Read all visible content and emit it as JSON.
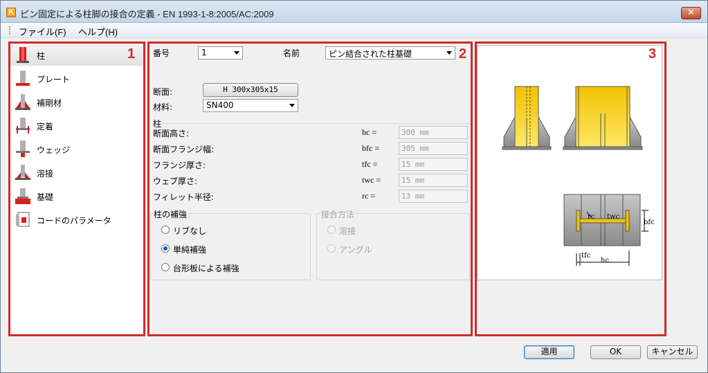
{
  "window": {
    "title": "ピン固定による柱脚の接合の定義 - EN 1993-1-8:2005/AC:2009",
    "close_label": "✕"
  },
  "menu": {
    "file": "ファイル(F)",
    "help": "ヘルプ(H)"
  },
  "regions": {
    "r1": "1",
    "r2": "2",
    "r3": "3"
  },
  "sidebar": {
    "items": [
      {
        "label": "柱",
        "icon": "column-icon"
      },
      {
        "label": "プレート",
        "icon": "plate-icon"
      },
      {
        "label": "補剛材",
        "icon": "stiffener-icon"
      },
      {
        "label": "定着",
        "icon": "anchor-icon"
      },
      {
        "label": "ウェッジ",
        "icon": "wedge-icon"
      },
      {
        "label": "溶接",
        "icon": "weld-icon"
      },
      {
        "label": "基礎",
        "icon": "foundation-icon"
      },
      {
        "label": "コードのパラメータ",
        "icon": "code-params-icon"
      }
    ]
  },
  "form": {
    "number_label": "番号",
    "number_value": "1",
    "name_label": "名前",
    "name_value": "ピン結合された柱基礎",
    "section_label": "断面:",
    "section_value": "H 300x305x15",
    "material_label": "材料:",
    "material_value": "SN400",
    "column_group": "柱",
    "rows": [
      {
        "label": "断面高さ:",
        "sym": "hc =",
        "value": "300 mm"
      },
      {
        "label": "断面フランジ幅:",
        "sym": "bfc =",
        "value": "305 mm"
      },
      {
        "label": "フランジ厚さ:",
        "sym": "tfc =",
        "value": "15 mm"
      },
      {
        "label": "ウェブ厚さ:",
        "sym": "twc =",
        "value": "15 mm"
      },
      {
        "label": "フィレット半径:",
        "sym": "rc =",
        "value": "13 mm"
      }
    ],
    "reinforcement_group": "柱の補強",
    "reinforcement_options": [
      "リブなし",
      "単純補強",
      "台形板による補強"
    ],
    "reinforcement_selected": 1,
    "joint_group": "接合方法",
    "joint_options": [
      "溶接",
      "アングル"
    ]
  },
  "diagram": {
    "labels": {
      "rc": "rc",
      "twc": "twc",
      "bfc": "bfc",
      "tfc": "tfc",
      "hc": "hc"
    },
    "colors": {
      "steel": "#f2c200",
      "steel_light": "#ffe866",
      "plate": "#9a9a9a"
    }
  },
  "buttons": {
    "apply": "適用",
    "ok": "OK",
    "cancel": "キャンセル"
  }
}
